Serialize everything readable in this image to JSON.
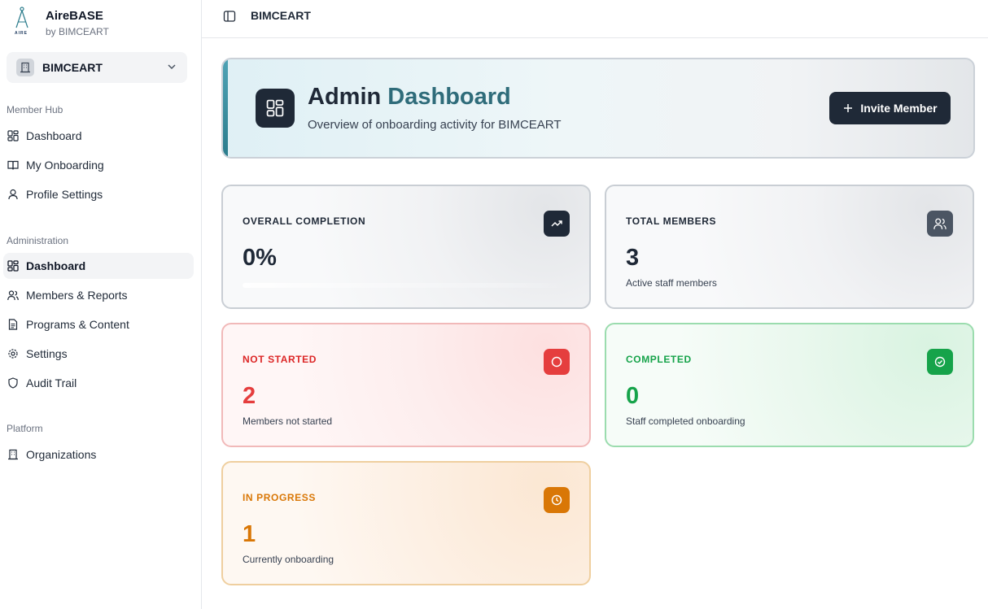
{
  "app": {
    "name": "AireBASE",
    "by": "by BIMCEART",
    "logo_text": "AIRE"
  },
  "org_switcher": {
    "name": "BIMCEART"
  },
  "sidebar": {
    "member_hub": {
      "label": "Member Hub",
      "items": [
        {
          "label": "Dashboard",
          "icon": "grid-icon"
        },
        {
          "label": "My Onboarding",
          "icon": "book-icon"
        },
        {
          "label": "Profile Settings",
          "icon": "user-icon"
        }
      ]
    },
    "administration": {
      "label": "Administration",
      "items": [
        {
          "label": "Dashboard",
          "icon": "grid-icon",
          "active": true
        },
        {
          "label": "Members & Reports",
          "icon": "users-icon"
        },
        {
          "label": "Programs & Content",
          "icon": "file-icon"
        },
        {
          "label": "Settings",
          "icon": "gear-icon"
        },
        {
          "label": "Audit Trail",
          "icon": "shield-icon"
        }
      ]
    },
    "platform": {
      "label": "Platform",
      "items": [
        {
          "label": "Organizations",
          "icon": "building-icon"
        }
      ]
    }
  },
  "topbar": {
    "breadcrumb": "BIMCEART"
  },
  "hero": {
    "title_part1": "Admin",
    "title_part2": "Dashboard",
    "subtitle": "Overview of onboarding activity for BIMCEART",
    "invite_label": "Invite Member"
  },
  "stats": {
    "overall": {
      "label": "OVERALL COMPLETION",
      "value": "0%",
      "progress": 0
    },
    "total": {
      "label": "TOTAL MEMBERS",
      "value": "3",
      "sub": "Active staff members"
    },
    "not_started": {
      "label": "NOT STARTED",
      "value": "2",
      "sub": "Members not started"
    },
    "completed": {
      "label": "COMPLETED",
      "value": "0",
      "sub": "Staff completed onboarding"
    },
    "in_progress": {
      "label": "IN PROGRESS",
      "value": "1",
      "sub": "Currently onboarding"
    }
  },
  "colors": {
    "dark": "#1f2937",
    "teal": "#2f6c7a",
    "red": "#e53e3e",
    "green": "#16a34a",
    "orange": "#d97706",
    "slate": "#4b5563"
  }
}
